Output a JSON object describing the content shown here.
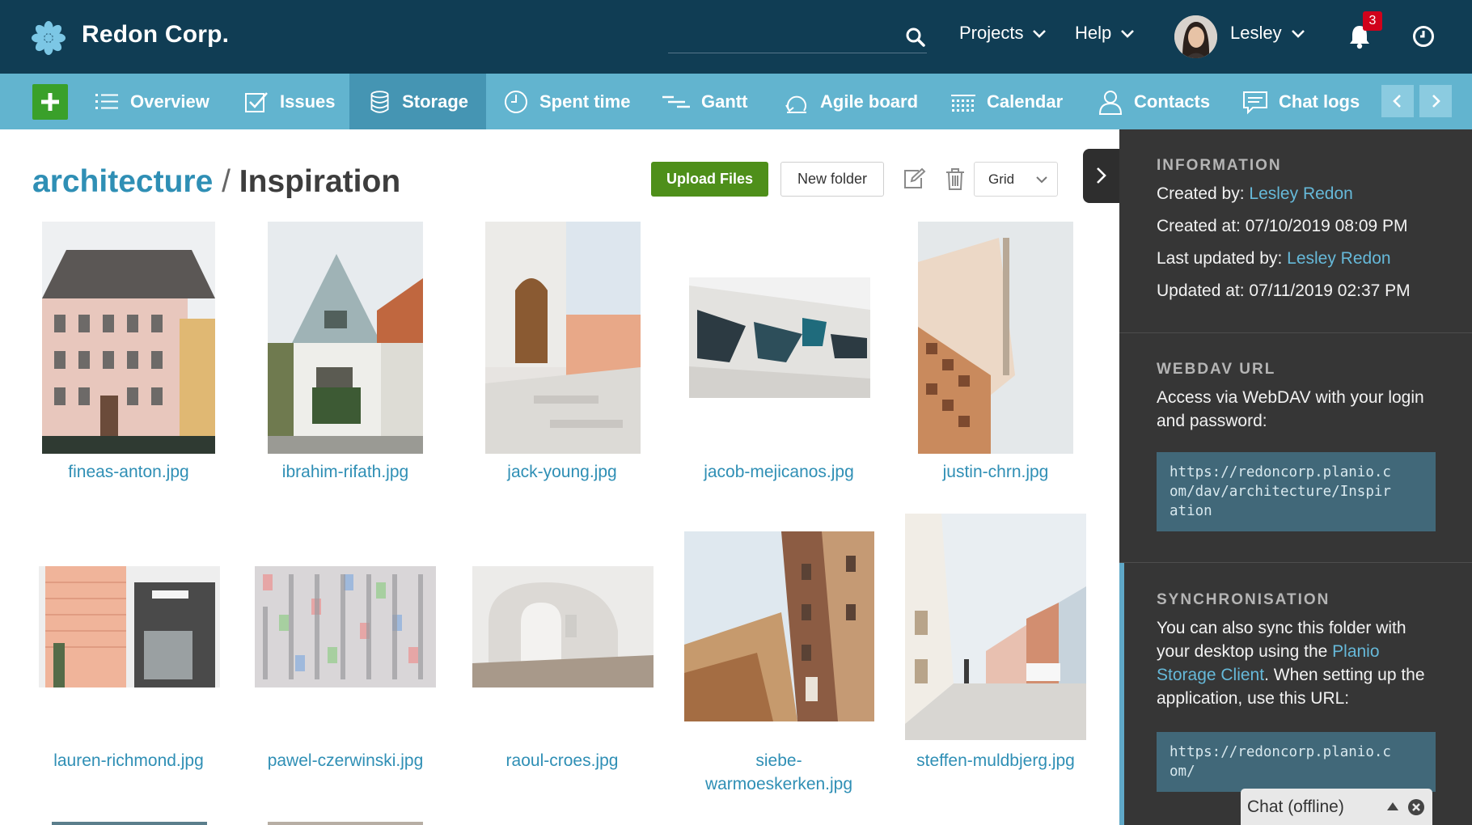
{
  "header": {
    "brand": "Redon Corp.",
    "search": {
      "placeholder": "",
      "icon": "search-icon"
    },
    "menus": [
      {
        "label": "Projects",
        "icon": "chevron-down-icon"
      },
      {
        "label": "Help",
        "icon": "chevron-down-icon"
      }
    ],
    "user": {
      "name": "Lesley",
      "icon": "chevron-down-icon"
    },
    "notifications": {
      "count": "3",
      "icon": "bell-icon"
    },
    "time_icon": "clock-icon"
  },
  "project_nav": {
    "add_icon": "plus-icon",
    "tabs": [
      {
        "label": "Overview",
        "icon": "list-icon",
        "active": false
      },
      {
        "label": "Issues",
        "icon": "checkbox-icon",
        "active": false
      },
      {
        "label": "Storage",
        "icon": "database-icon",
        "active": true
      },
      {
        "label": "Spent time",
        "icon": "clock-icon",
        "active": false
      },
      {
        "label": "Gantt",
        "icon": "gantt-icon",
        "active": false
      },
      {
        "label": "Agile board",
        "icon": "agile-icon",
        "active": false
      },
      {
        "label": "Calendar",
        "icon": "calendar-icon",
        "active": false
      },
      {
        "label": "Contacts",
        "icon": "person-icon",
        "active": false
      },
      {
        "label": "Chat logs",
        "icon": "chat-icon",
        "active": false
      }
    ],
    "prev_icon": "chevron-left-icon",
    "next_icon": "chevron-right-icon"
  },
  "breadcrumb": {
    "parent": "architecture",
    "separator": "/",
    "current": "Inspiration"
  },
  "toolbar": {
    "upload_label": "Upload Files",
    "new_folder_label": "New folder",
    "edit_icon": "edit-icon",
    "delete_icon": "trash-icon",
    "view_mode": "Grid"
  },
  "files": [
    {
      "name": "fineas-anton.jpg"
    },
    {
      "name": "ibrahim-rifath.jpg"
    },
    {
      "name": "jack-young.jpg"
    },
    {
      "name": "jacob-mejicanos.jpg"
    },
    {
      "name": "justin-chrn.jpg"
    },
    {
      "name": "lauren-richmond.jpg"
    },
    {
      "name": "pawel-czerwinski.jpg"
    },
    {
      "name": "raoul-croes.jpg"
    },
    {
      "name": "siebe-",
      "name_line2": "warmoeskerken.jpg"
    },
    {
      "name": "steffen-muldbjerg.jpg"
    }
  ],
  "sidebar": {
    "information": {
      "title": "INFORMATION",
      "created_by_label": "Created by:",
      "created_by": "Lesley Redon",
      "created_at": "Created at: 07/10/2019 08:09 PM",
      "updated_by_label": "Last updated by:",
      "updated_by": "Lesley Redon",
      "updated_at": "Updated at: 07/11/2019 02:37 PM"
    },
    "webdav": {
      "title": "WEBDAV URL",
      "text": "Access via WebDAV with your login and password:",
      "url": "https://redoncorp.planio.c\nom/dav/architecture/Inspir\nation"
    },
    "sync": {
      "title": "SYNCHRONISATION",
      "text_before": "You can also sync this folder with your desktop using the",
      "link": "Planio Storage Client",
      "text_after": ". When setting up the application, use this URL:",
      "url": "https://redoncorp.planio.c\nom/"
    },
    "collapse_icon": "chevron-right-icon"
  },
  "chat": {
    "label": "Chat (offline)",
    "expand_icon": "caret-up-icon",
    "close_icon": "close-icon"
  },
  "colors": {
    "header_bg": "#103d54",
    "nav_bg": "#62b4cf",
    "nav_active": "#4595b3",
    "accent_green": "#4e8f1a",
    "link_blue": "#2f8fb5",
    "sidebar_bg": "#363636",
    "badge_red": "#d0021b"
  }
}
